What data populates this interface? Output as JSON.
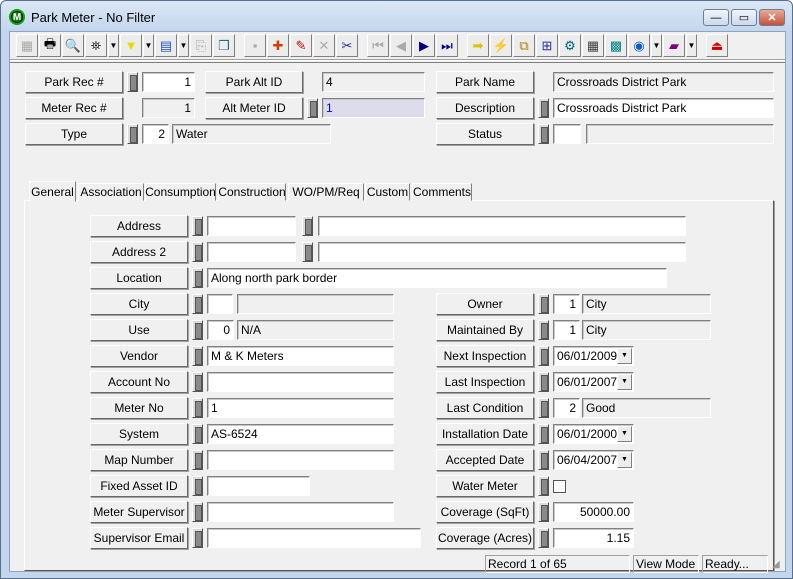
{
  "window": {
    "title": "Park Meter - No Filter",
    "app_icon_letter": "M",
    "minimize": "—",
    "maximize": "▭",
    "close": "✕"
  },
  "toolbar": [
    {
      "name": "display-icon",
      "glyph": "▦",
      "disabled": true
    },
    {
      "name": "print-icon",
      "glyph": "🖶"
    },
    {
      "name": "preview-icon",
      "glyph": "🔍"
    },
    {
      "name": "find-icon",
      "glyph": "⛯",
      "dropdown": true,
      "color": "#333"
    },
    {
      "name": "filter-icon",
      "glyph": "▼",
      "dropdown": true,
      "color": "#e8d800"
    },
    {
      "name": "report-icon",
      "glyph": "▤",
      "dropdown": true,
      "color": "#2050c0"
    },
    {
      "name": "properties-icon",
      "glyph": "⎘",
      "disabled": true
    },
    {
      "name": "copy-record-icon",
      "glyph": "❐",
      "color": "#1a6f8a"
    },
    {
      "name": "save-icon",
      "glyph": "▪",
      "disabled": true,
      "gap": true
    },
    {
      "name": "add-record-icon",
      "glyph": "✚",
      "color": "#d04000"
    },
    {
      "name": "edit-icon",
      "glyph": "✎",
      "color": "#c01000"
    },
    {
      "name": "delete-icon",
      "glyph": "✕",
      "disabled": true
    },
    {
      "name": "cut-icon",
      "glyph": "✂",
      "color": "#1a2a9a"
    },
    {
      "name": "first-record-icon",
      "glyph": "⏮",
      "disabled": true,
      "gap": true
    },
    {
      "name": "previous-record-icon",
      "glyph": "◀",
      "disabled": true
    },
    {
      "name": "next-record-icon",
      "glyph": "▶",
      "color": "#000080"
    },
    {
      "name": "last-record-icon",
      "glyph": "⏭",
      "color": "#000080"
    },
    {
      "name": "go-arrow-icon",
      "glyph": "➡",
      "color": "#e0c000",
      "gap": true
    },
    {
      "name": "lightning-icon",
      "glyph": "⚡",
      "color": "#d0b000"
    },
    {
      "name": "map-tools-icon",
      "glyph": "⧉",
      "color": "#b08000"
    },
    {
      "name": "hierarchy-icon",
      "glyph": "⊞",
      "color": "#2030a0"
    },
    {
      "name": "equipment-icon",
      "glyph": "⚙",
      "color": "#006080"
    },
    {
      "name": "calculator-icon",
      "glyph": "▦",
      "color": "#404040"
    },
    {
      "name": "map-icon",
      "glyph": "▩",
      "color": "#008080"
    },
    {
      "name": "globe-icon",
      "glyph": "◉",
      "dropdown": true,
      "color": "#1060c0"
    },
    {
      "name": "book-icon",
      "glyph": "▰",
      "dropdown": true,
      "color": "#800080"
    },
    {
      "name": "exit-icon",
      "glyph": "⏏",
      "color": "#d00000",
      "gap": true
    }
  ],
  "header": {
    "park_rec": {
      "label": "Park Rec #",
      "value": "1"
    },
    "park_alt_id": {
      "label": "Park Alt ID",
      "value": "4"
    },
    "park_name": {
      "label": "Park Name",
      "value": "Crossroads District Park"
    },
    "meter_rec": {
      "label": "Meter Rec #",
      "value": "1"
    },
    "alt_meter_id": {
      "label": "Alt Meter ID",
      "value": "1"
    },
    "description": {
      "label": "Description",
      "value": "Crossroads District Park"
    },
    "type": {
      "label": "Type",
      "code": "2",
      "value": "Water"
    },
    "status": {
      "label": "Status",
      "code": "",
      "value": ""
    }
  },
  "tabs": [
    "General",
    "Association",
    "Consumption",
    "Construction",
    "WO/PM/Req",
    "Custom",
    "Comments"
  ],
  "active_tab": "General",
  "general": {
    "address": {
      "label": "Address",
      "v1": "",
      "v2": ""
    },
    "address2": {
      "label": "Address 2",
      "v1": "",
      "v2": ""
    },
    "location": {
      "label": "Location",
      "value": "Along north park border"
    },
    "city": {
      "label": "City",
      "code": "",
      "value": ""
    },
    "use": {
      "label": "Use",
      "code": "0",
      "value": "N/A"
    },
    "vendor": {
      "label": "Vendor",
      "value": "M & K Meters"
    },
    "account_no": {
      "label": "Account No",
      "value": ""
    },
    "meter_no": {
      "label": "Meter No",
      "value": "1"
    },
    "system": {
      "label": "System",
      "value": "AS-6524"
    },
    "map_number": {
      "label": "Map Number",
      "value": ""
    },
    "fixed_asset_id": {
      "label": "Fixed Asset ID",
      "value": ""
    },
    "meter_supervisor": {
      "label": "Meter Supervisor",
      "value": ""
    },
    "supervisor_email": {
      "label": "Supervisor Email",
      "value": ""
    },
    "owner": {
      "label": "Owner",
      "code": "1",
      "value": "City"
    },
    "maintained_by": {
      "label": "Maintained By",
      "code": "1",
      "value": "City"
    },
    "next_inspection": {
      "label": "Next Inspection",
      "value": "06/01/2009"
    },
    "last_inspection": {
      "label": "Last Inspection",
      "value": "06/01/2007"
    },
    "last_condition": {
      "label": "Last Condition",
      "code": "2",
      "value": "Good"
    },
    "installation_date": {
      "label": "Installation Date",
      "value": "06/01/2000"
    },
    "accepted_date": {
      "label": "Accepted Date",
      "value": "06/04/2007"
    },
    "water_meter": {
      "label": "Water Meter",
      "checked": false
    },
    "coverage_sqft": {
      "label": "Coverage (SqFt)",
      "value": "50000.00"
    },
    "coverage_acres": {
      "label": "Coverage (Acres)",
      "value": "1.15"
    }
  },
  "statusbar": {
    "record": "Record 1 of 65",
    "mode": "View Mode",
    "state": "Ready..."
  }
}
